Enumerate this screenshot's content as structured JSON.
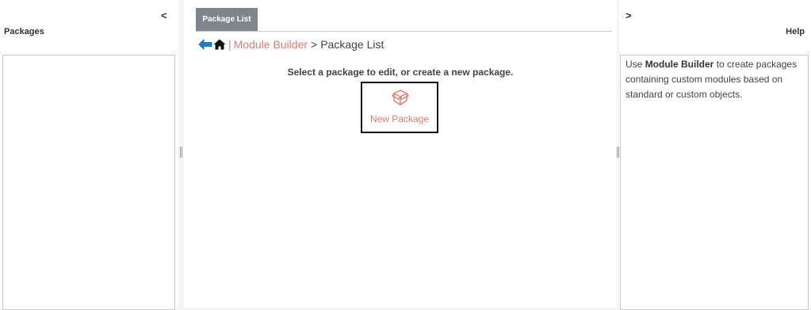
{
  "left_panel": {
    "collapse_label": "<",
    "title": "Packages"
  },
  "center": {
    "tab_label": "Package List",
    "breadcrumb": {
      "separator": "|",
      "link": "Module Builder",
      "gt": ">",
      "current": "Package List"
    },
    "instruction": "Select a package to edit, or create a new package.",
    "new_package_label": "New Package"
  },
  "right_panel": {
    "expand_label": ">",
    "title": "Help",
    "help": {
      "prefix": "Use ",
      "bold": "Module Builder",
      "suffix": " to create packages containing custom modules based on standard or custom objects."
    }
  },
  "icons": {
    "back": "back-arrow-icon",
    "home": "home-icon",
    "package": "package-box-icon"
  },
  "colors": {
    "accent": "#e07b6d",
    "tab_bg": "#7d868c",
    "back_arrow": "#1a7fd6"
  }
}
